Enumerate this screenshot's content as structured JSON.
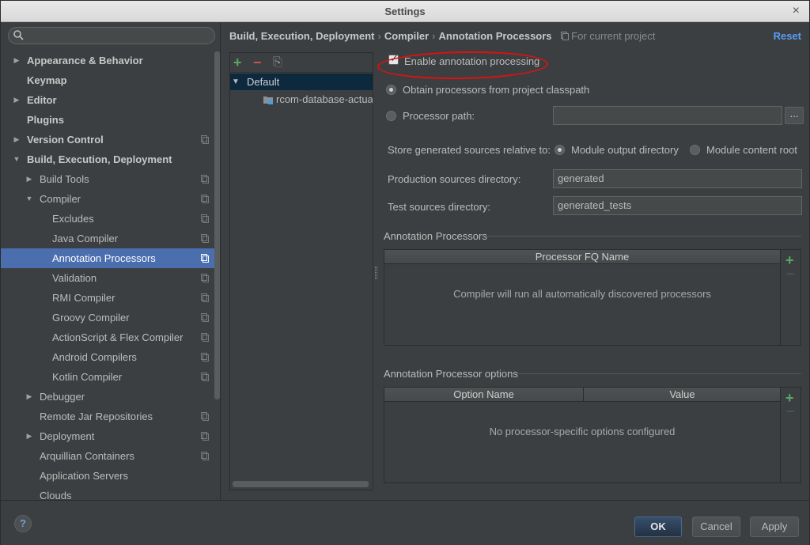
{
  "window": {
    "title": "Settings",
    "close": "×"
  },
  "search": {
    "placeholder": "",
    "value": ""
  },
  "sidebar": {
    "items": [
      {
        "label": "Appearance & Behavior",
        "bold": true,
        "arrow": "▶",
        "level": 0,
        "project": false
      },
      {
        "label": "Keymap",
        "bold": true,
        "arrow": "",
        "level": 0,
        "project": false
      },
      {
        "label": "Editor",
        "bold": true,
        "arrow": "▶",
        "level": 0,
        "project": false
      },
      {
        "label": "Plugins",
        "bold": true,
        "arrow": "",
        "level": 0,
        "project": false
      },
      {
        "label": "Version Control",
        "bold": true,
        "arrow": "▶",
        "level": 0,
        "project": true
      },
      {
        "label": "Build, Execution, Deployment",
        "bold": true,
        "arrow": "▼",
        "level": 0,
        "project": false
      },
      {
        "label": "Build Tools",
        "bold": false,
        "arrow": "▶",
        "level": 1,
        "project": true
      },
      {
        "label": "Compiler",
        "bold": false,
        "arrow": "▼",
        "level": 1,
        "project": true
      },
      {
        "label": "Excludes",
        "bold": false,
        "arrow": "",
        "level": 2,
        "project": true
      },
      {
        "label": "Java Compiler",
        "bold": false,
        "arrow": "",
        "level": 2,
        "project": true
      },
      {
        "label": "Annotation Processors",
        "bold": false,
        "arrow": "",
        "level": 2,
        "project": true,
        "selected": true
      },
      {
        "label": "Validation",
        "bold": false,
        "arrow": "",
        "level": 2,
        "project": true
      },
      {
        "label": "RMI Compiler",
        "bold": false,
        "arrow": "",
        "level": 2,
        "project": true
      },
      {
        "label": "Groovy Compiler",
        "bold": false,
        "arrow": "",
        "level": 2,
        "project": true
      },
      {
        "label": "ActionScript & Flex Compiler",
        "bold": false,
        "arrow": "",
        "level": 2,
        "project": true
      },
      {
        "label": "Android Compilers",
        "bold": false,
        "arrow": "",
        "level": 2,
        "project": true
      },
      {
        "label": "Kotlin Compiler",
        "bold": false,
        "arrow": "",
        "level": 2,
        "project": true
      },
      {
        "label": "Debugger",
        "bold": false,
        "arrow": "▶",
        "level": 1,
        "project": false
      },
      {
        "label": "Remote Jar Repositories",
        "bold": false,
        "arrow": "",
        "level": 1,
        "project": true
      },
      {
        "label": "Deployment",
        "bold": false,
        "arrow": "▶",
        "level": 1,
        "project": true
      },
      {
        "label": "Arquillian Containers",
        "bold": false,
        "arrow": "",
        "level": 1,
        "project": true
      },
      {
        "label": "Application Servers",
        "bold": false,
        "arrow": "",
        "level": 1,
        "project": false
      },
      {
        "label": "Clouds",
        "bold": false,
        "arrow": "",
        "level": 1,
        "project": false
      }
    ]
  },
  "breadcrumb": {
    "parts": [
      "Build, Execution, Deployment",
      "Compiler",
      "Annotation Processors"
    ],
    "separator": "›",
    "scope": "For current project",
    "reset": "Reset"
  },
  "profiles": {
    "add": "+",
    "remove": "−",
    "move": "⎘",
    "items": [
      {
        "label": "Default",
        "arrow": "▼"
      },
      {
        "label": "rcom-database-actua"
      }
    ]
  },
  "options": {
    "enable_label": "Enable annotation processing",
    "enable_checked": true,
    "obtain_label": "Obtain processors from project classpath",
    "processor_path_label": "Processor path:",
    "processor_path_value": "",
    "browse": "...",
    "store_label": "Store generated sources relative to:",
    "module_output": "Module output directory",
    "module_content": "Module content root",
    "prod_label": "Production sources directory:",
    "prod_value": "generated",
    "test_label": "Test sources directory:",
    "test_value": "generated_tests"
  },
  "processors_table": {
    "section": "Annotation Processors",
    "header": "Processor FQ Name",
    "empty": "Compiler will run all automatically discovered processors",
    "add": "+",
    "remove": "−"
  },
  "options_table": {
    "section": "Annotation Processor options",
    "col1": "Option Name",
    "col2": "Value",
    "empty": "No processor-specific options configured",
    "add": "+",
    "remove": "−"
  },
  "footer": {
    "help": "?",
    "ok": "OK",
    "cancel": "Cancel",
    "apply": "Apply"
  },
  "colors": {
    "accent": "#4b6eaf",
    "link": "#589df6",
    "add": "#59a869",
    "remove": "#c75450",
    "highlight": "#e01010"
  }
}
